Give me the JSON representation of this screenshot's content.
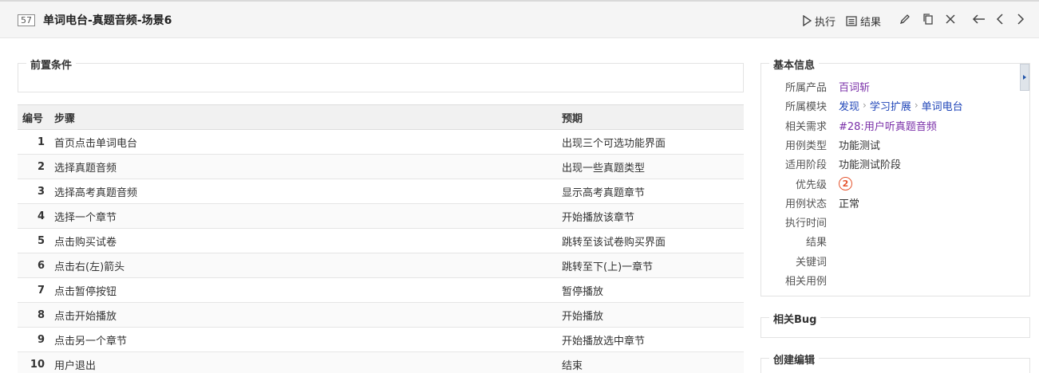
{
  "header": {
    "case_id": "57",
    "title": "单词电台-真题音频-场景6",
    "run_label": "执行",
    "results_label": "结果"
  },
  "precondition": {
    "legend": "前置条件"
  },
  "steps_table": {
    "headers": {
      "num": "编号",
      "step": "步骤",
      "expect": "预期"
    },
    "rows": [
      {
        "num": "1",
        "step": "首页点击单词电台",
        "expect": "出现三个可选功能界面"
      },
      {
        "num": "2",
        "step": "选择真题音频",
        "expect": "出现一些真题类型"
      },
      {
        "num": "3",
        "step": "选择高考真题音频",
        "expect": "显示高考真题章节"
      },
      {
        "num": "4",
        "step": "选择一个章节",
        "expect": "开始播放该章节"
      },
      {
        "num": "5",
        "step": "点击购买试卷",
        "expect": "跳转至该试卷购买界面"
      },
      {
        "num": "6",
        "step": "点击右(左)箭头",
        "expect": "跳转至下(上)一章节"
      },
      {
        "num": "7",
        "step": "点击暂停按钮",
        "expect": "暂停播放"
      },
      {
        "num": "8",
        "step": "点击开始播放",
        "expect": "开始播放"
      },
      {
        "num": "9",
        "step": "点击另一个章节",
        "expect": "开始播放选中章节"
      },
      {
        "num": "10",
        "step": "用户退出",
        "expect": "结束"
      }
    ]
  },
  "basic_info": {
    "legend": "基本信息",
    "product_label": "所属产品",
    "product": "百词斩",
    "module_label": "所属模块",
    "module_path": [
      "发现",
      "学习扩展",
      "单词电台"
    ],
    "story_label": "相关需求",
    "story": "#28:用户听真题音频",
    "type_label": "用例类型",
    "type": "功能测试",
    "stage_label": "适用阶段",
    "stage": "功能测试阶段",
    "priority_label": "优先级",
    "priority": "2",
    "status_label": "用例状态",
    "status": "正常",
    "exec_time_label": "执行时间",
    "result_label": "结果",
    "keywords_label": "关键词",
    "linked_cases_label": "相关用例"
  },
  "related_bug": {
    "legend": "相关Bug"
  },
  "create_edit": {
    "legend": "创建编辑"
  },
  "colors": {
    "link": "#1f45b8",
    "story_link": "#7a2fa8",
    "priority": "#e5552f"
  }
}
